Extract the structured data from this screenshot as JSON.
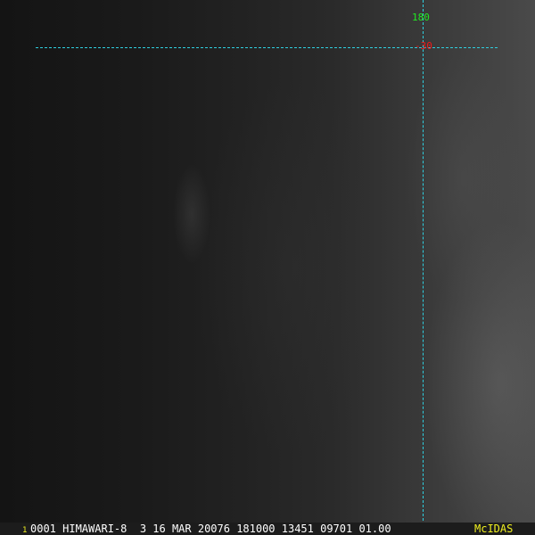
{
  "image": {
    "title": "HIMAWARI-8 visible satellite image",
    "grid": {
      "longitude_label": "180",
      "latitude_label": "-30"
    },
    "colors": {
      "grid": "#2fd0e0",
      "lon_label": "#22e822",
      "lat_label": "#f01818",
      "brand": "#f0f020"
    }
  },
  "status_bar": {
    "frame_number": "1",
    "info": "0001 HIMAWARI-8  3 16 MAR 20076 181000 13451 09701 01.00",
    "brand": "McIDAS"
  }
}
